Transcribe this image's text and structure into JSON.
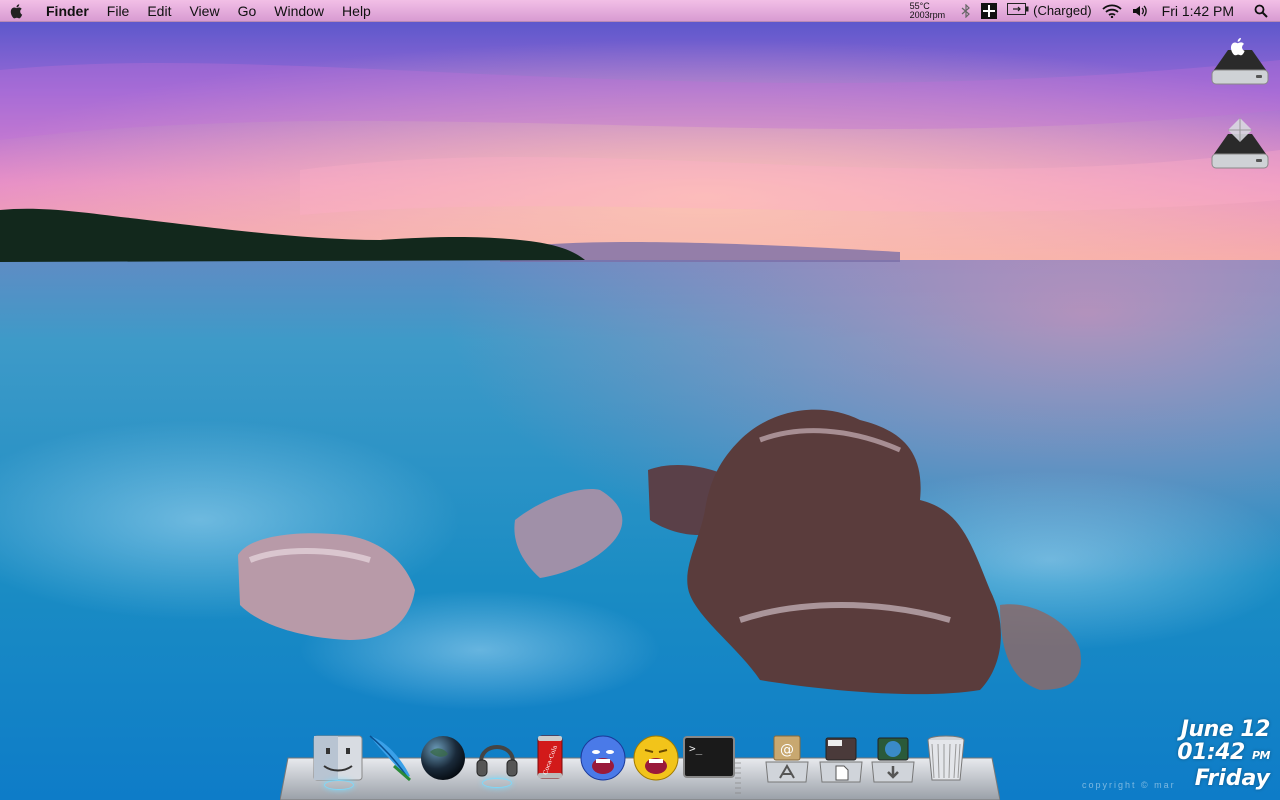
{
  "menubar": {
    "app_name": "Finder",
    "menus": [
      "File",
      "Edit",
      "View",
      "Go",
      "Window",
      "Help"
    ],
    "temperature": "55°C",
    "fan_speed": "2003rpm",
    "battery_status": "(Charged)",
    "clock": "Fri 1:42 PM"
  },
  "desktop": {
    "drives": [
      {
        "icon": "apple-drive-icon"
      },
      {
        "icon": "windows-drive-icon"
      }
    ]
  },
  "dock": {
    "apps": [
      {
        "name": "Finder",
        "icon": "finder-icon",
        "running": true
      },
      {
        "name": "Feather",
        "icon": "feather-icon",
        "running": false
      },
      {
        "name": "Globe",
        "icon": "globe-icon",
        "running": false
      },
      {
        "name": "Headphones",
        "icon": "headphones-icon",
        "running": true
      },
      {
        "name": "Coca-Cola",
        "icon": "cola-can-icon",
        "running": false
      },
      {
        "name": "Blue Face",
        "icon": "blue-face-icon",
        "running": false
      },
      {
        "name": "Yellow Face",
        "icon": "yellow-face-icon",
        "running": false
      },
      {
        "name": "Terminal",
        "icon": "terminal-icon",
        "running": false
      }
    ],
    "stacks": [
      {
        "name": "Applications",
        "icon": "applications-stack-icon"
      },
      {
        "name": "Documents",
        "icon": "documents-stack-icon"
      },
      {
        "name": "Downloads",
        "icon": "downloads-stack-icon"
      },
      {
        "name": "Trash",
        "icon": "trash-icon"
      }
    ],
    "terminal_prompt": ">_",
    "cola_label": "Coca-Cola"
  },
  "date_widget": {
    "date": "June 12",
    "time": "01:42",
    "ampm": "PM",
    "day": "Friday"
  },
  "copyright": "copyright © mar"
}
